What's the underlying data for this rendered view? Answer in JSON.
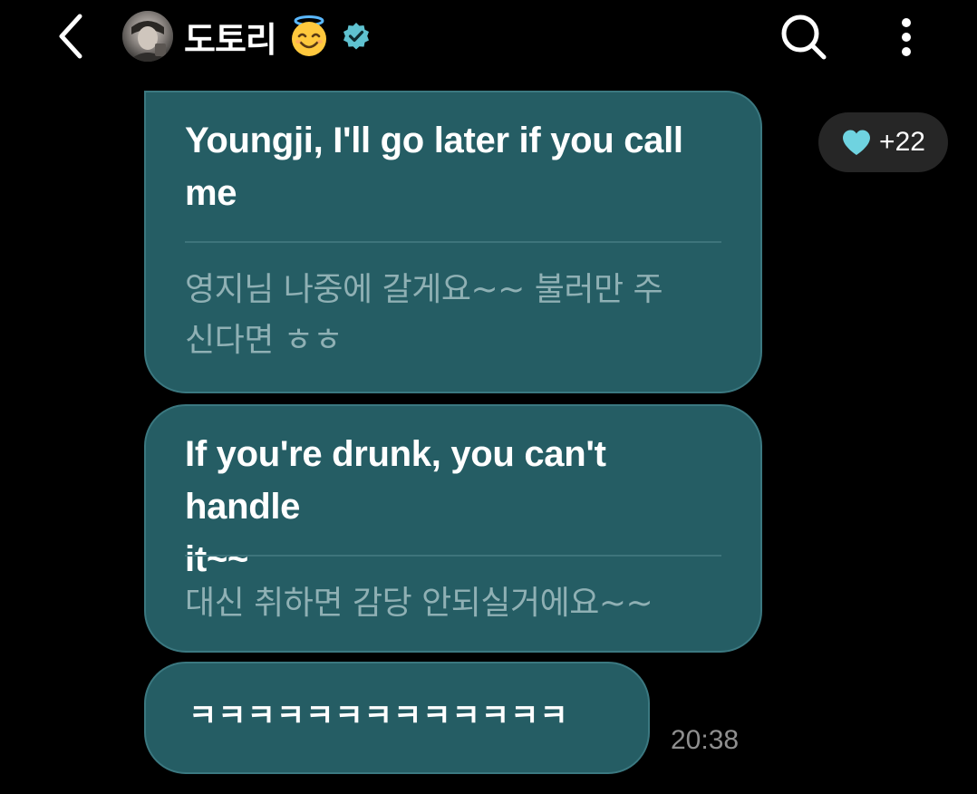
{
  "header": {
    "title": "도토리",
    "back_icon": "chevron-left-icon",
    "emoji": "smiling-face-with-halo",
    "verified_icon": "verified-badge-icon",
    "search_icon": "search-icon",
    "more_icon": "more-vertical-icon"
  },
  "reaction": {
    "icon": "heart-icon",
    "count": "+22",
    "heart_color": "#6fd3e0"
  },
  "messages": [
    {
      "text_en_line1": "Youngji, I'll go later if you call",
      "text_en_line2": "me",
      "text_ko_line1": "영지님 나중에 갈게요~~ 불러만 주",
      "text_ko_line2": "신다면 ㅎㅎ"
    },
    {
      "text_en_line1": "If you're drunk, you can't handle",
      "text_en_line2": "it~~",
      "text_ko_line1": "대신 취하면 감당 안되실거에요~~"
    },
    {
      "text": "ㅋㅋㅋㅋㅋㅋㅋㅋㅋㅋㅋㅋㅋ"
    }
  ],
  "timestamp": "20:38",
  "colors": {
    "background": "#000000",
    "bubble": "#255d64",
    "bubble_border": "#3b7880",
    "translation_text": "#8fb0b4",
    "timestamp_text": "#8f8f8f",
    "verified": "#5fc2d0"
  }
}
